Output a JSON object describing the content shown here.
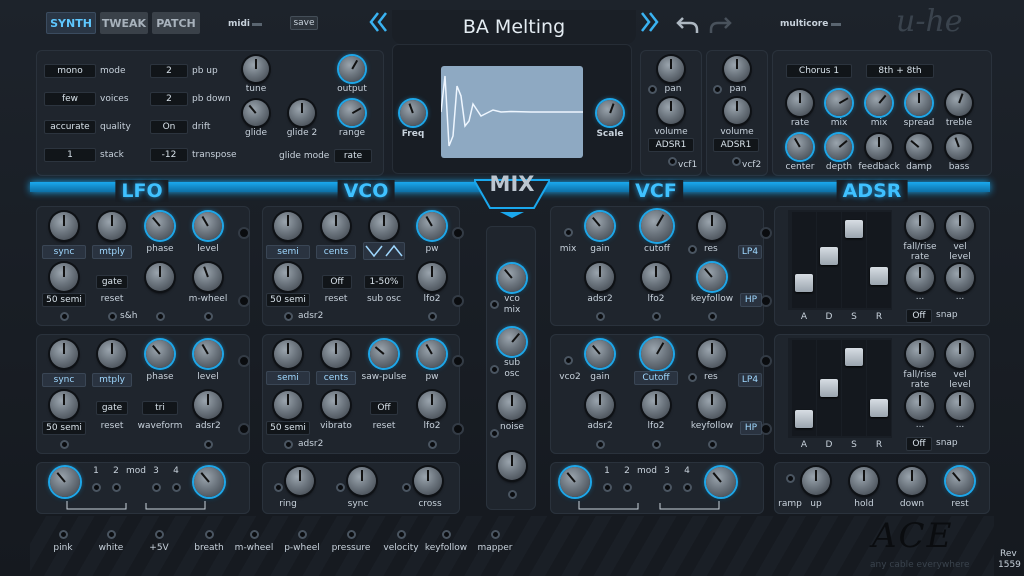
{
  "header": {
    "tabs": [
      {
        "label": "SYNTH",
        "active": true
      },
      {
        "label": "TWEAK",
        "active": false
      },
      {
        "label": "PATCH",
        "active": false
      }
    ],
    "midi_label": "midi",
    "save_label": "save",
    "preset_name": "BA Melting",
    "multicore_label": "multicore",
    "brand": "u-he"
  },
  "global": {
    "mode": {
      "value": "mono",
      "label": "mode"
    },
    "voices": {
      "value": "few",
      "label": "voices"
    },
    "quality": {
      "value": "accurate",
      "label": "quality"
    },
    "stack": {
      "value": "1",
      "label": "stack"
    },
    "pb_up": {
      "value": "2",
      "label": "pb up"
    },
    "pb_down": {
      "value": "2",
      "label": "pb down"
    },
    "drift": {
      "value": "On",
      "label": "drift"
    },
    "transpose": {
      "value": "-12",
      "label": "transpose"
    },
    "tune_label": "tune",
    "output_label": "output",
    "glide_label": "glide",
    "glide2_label": "glide 2",
    "range_label": "range",
    "glide_mode_label": "glide mode",
    "glide_mode_value": "rate"
  },
  "scope": {
    "freq_label": "Freq",
    "scale_label": "Scale"
  },
  "vcf_out": {
    "pan_label": "pan",
    "volume_label": "volume",
    "vcf1_mod": "ADSR1",
    "vcf2_mod": "ADSR1",
    "vcf1_label": "vcf1",
    "vcf2_label": "vcf2"
  },
  "chorus": {
    "type": "Chorus 1",
    "rate_value": "8th + 8th",
    "labels": {
      "rate": "rate",
      "mix": "mix",
      "mix2": "mix",
      "spread": "spread",
      "treble": "treble",
      "center": "center",
      "depth": "depth",
      "feedback": "feedback",
      "damp": "damp",
      "bass": "bass"
    }
  },
  "sections": {
    "lfo": "LFO",
    "vco": "VCO",
    "mix": "MIX",
    "vcf": "VCF",
    "adsr": "ADSR"
  },
  "lfo": [
    {
      "sync": "sync",
      "mult": "mtply",
      "phase": "phase",
      "level": "level",
      "range": "50 semi",
      "gate": "gate",
      "reset": "reset",
      "sh": "s&h",
      "mod": "m-wheel"
    },
    {
      "sync": "sync",
      "mult": "mtply",
      "phase": "phase",
      "level": "level",
      "range": "50 semi",
      "gate": "gate",
      "reset": "reset",
      "wave_val": "tri",
      "wave": "waveform",
      "mod": "adsr2"
    }
  ],
  "vco": [
    {
      "semi": "semi",
      "cents": "cents",
      "pw": "pw",
      "range": "50 semi",
      "reset_val": "Off",
      "reset": "reset",
      "subosc_val": "1-50%",
      "subosc": "sub osc",
      "lfo2": "lfo2",
      "adsr2": "adsr2"
    },
    {
      "semi": "semi",
      "cents": "cents",
      "sawpulse": "saw-pulse",
      "pw": "pw",
      "range": "50 semi",
      "vibrato": "vibrato",
      "reset_val": "Off",
      "reset": "reset",
      "lfo2": "lfo2",
      "adsr2": "adsr2"
    }
  ],
  "mixer": {
    "vco": "vco mix",
    "sub": "sub osc",
    "noise": "noise"
  },
  "vcf": [
    {
      "mix": "mix",
      "gain": "gain",
      "cutoff": "cutoff",
      "res": "res",
      "mode": "LP4",
      "adsr2": "adsr2",
      "lfo2": "lfo2",
      "keyfollow": "keyfollow",
      "hp": "HP"
    },
    {
      "vco2": "vco2",
      "gain": "gain",
      "cutoff": "Cutoff",
      "res": "res",
      "mode": "LP4",
      "adsr2": "adsr2",
      "lfo2": "lfo2",
      "keyfollow": "keyfollow",
      "hp": "HP"
    }
  ],
  "env": [
    {
      "fall": "fall/rise",
      "rate": "rate",
      "vel": "vel",
      "level": "level",
      "dots1": "...",
      "dots2": "...",
      "snap_val": "Off",
      "snap": "snap",
      "a": "A",
      "d": "D",
      "s": "S",
      "r": "R",
      "sliders": {
        "A": 0.2,
        "D": 0.55,
        "S": 0.9,
        "R": 0.3
      }
    },
    {
      "fall": "fall/rise",
      "rate": "rate",
      "vel": "vel",
      "level": "level",
      "dots1": "...",
      "dots2": "...",
      "snap_val": "Off",
      "snap": "snap",
      "a": "A",
      "d": "D",
      "s": "S",
      "r": "R",
      "sliders": {
        "A": 0.1,
        "D": 0.5,
        "S": 0.9,
        "R": 0.25
      }
    }
  ],
  "matrix": {
    "n1": "1",
    "n2": "2",
    "mod": "mod",
    "n3": "3",
    "n4": "4"
  },
  "lower": {
    "ring": "ring",
    "sync": "sync",
    "cross": "cross",
    "ramp": "ramp",
    "up": "up",
    "hold": "hold",
    "down": "down",
    "rest": "rest"
  },
  "sources": [
    "pink",
    "white",
    "+5V",
    "breath",
    "m-wheel",
    "p-wheel",
    "pressure",
    "velocity",
    "keyfollow",
    "mapper"
  ],
  "ace": {
    "logo": "ACE",
    "tagline": "any cable everywhere"
  },
  "rev": {
    "label": "Rev",
    "number": "1559"
  },
  "colors": {
    "accent": "#2fb6ff",
    "panel": "#1f252d",
    "screen": "#8ea9c2"
  }
}
